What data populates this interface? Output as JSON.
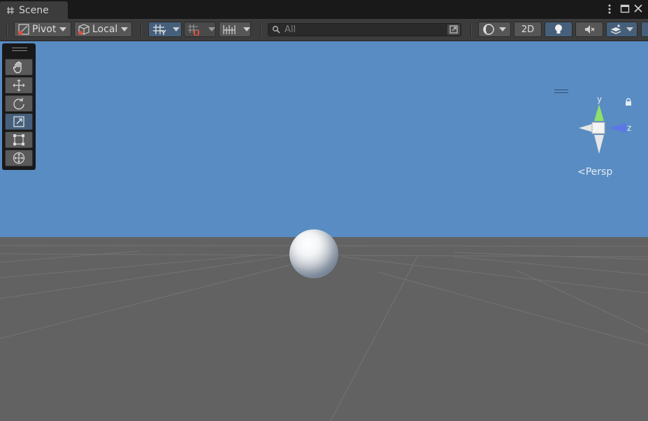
{
  "window": {
    "tab_title": "Scene",
    "menu_icon": "kebab-menu-icon",
    "maximize_icon": "maximize-icon",
    "close_icon": "close-icon"
  },
  "toolbar": {
    "pivot_label": "Pivot",
    "local_label": "Local",
    "search_placeholder": "All",
    "mode_2d_label": "2D"
  },
  "tools": [
    {
      "name": "hand-tool",
      "icon": "hand-icon",
      "active": false
    },
    {
      "name": "move-tool",
      "icon": "move-arrows-icon",
      "active": false
    },
    {
      "name": "rotate-tool",
      "icon": "rotate-icon",
      "active": false
    },
    {
      "name": "scale-tool",
      "icon": "scale-icon",
      "active": true
    },
    {
      "name": "rect-tool",
      "icon": "rect-icon",
      "active": false
    },
    {
      "name": "transform-tool",
      "icon": "transform-icon",
      "active": false
    }
  ],
  "gizmo": {
    "y_label": "y",
    "z_label": "z",
    "projection_label": "Persp"
  },
  "colors": {
    "sky": "#598cc2",
    "ground": "#626262",
    "accent_active": "#46607c",
    "axis_y": "#8ee06a",
    "axis_z": "#5b79e6"
  }
}
